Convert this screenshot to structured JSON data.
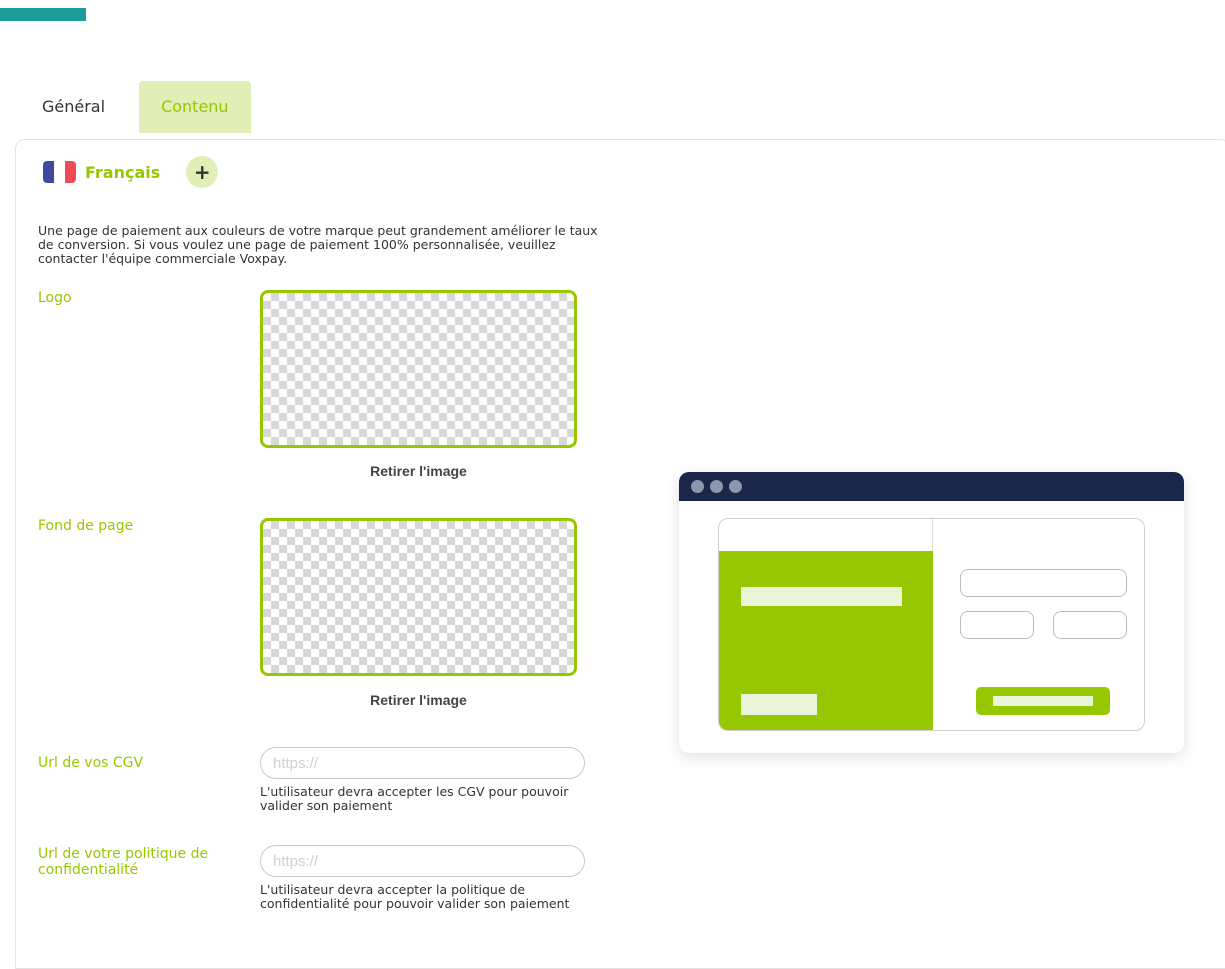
{
  "colors": {
    "accent": "#97c700",
    "accent_light": "#e1efb6",
    "top_bar": "#1a9c9a",
    "preview_header": "#1b2749",
    "preview_dot": "#8a97ad",
    "preview_pale": "#eaf4d6",
    "flag_blue": "#3c4b9f",
    "flag_white": "#ffffff",
    "flag_red": "#f04b55"
  },
  "tabs": [
    {
      "label": "Général",
      "active": false
    },
    {
      "label": "Contenu",
      "active": true
    }
  ],
  "language": {
    "label": "Français",
    "flag_icon": "france-flag-icon",
    "add_icon": "plus-icon",
    "add_label": "+"
  },
  "intro_text": "Une page de paiement aux couleurs de votre marque peut grandement améliorer le taux de conversion. Si vous voulez une page de paiement 100% personnalisée, veuillez contacter l'équipe commerciale Voxpay.",
  "logo": {
    "label": "Logo",
    "remove_label": "Retirer l'image"
  },
  "background": {
    "label": "Fond de page",
    "remove_label": "Retirer l'image"
  },
  "cgv": {
    "label": "Url de vos CGV",
    "placeholder": "https://",
    "value": "",
    "help": "L'utilisateur devra accepter les CGV pour pouvoir valider son paiement"
  },
  "privacy": {
    "label": "Url de votre politique de confidentialité",
    "placeholder": "https://",
    "value": "",
    "help": "L'utilisateur devra accepter la politique de confidentialité pour pouvoir valider son paiement"
  }
}
